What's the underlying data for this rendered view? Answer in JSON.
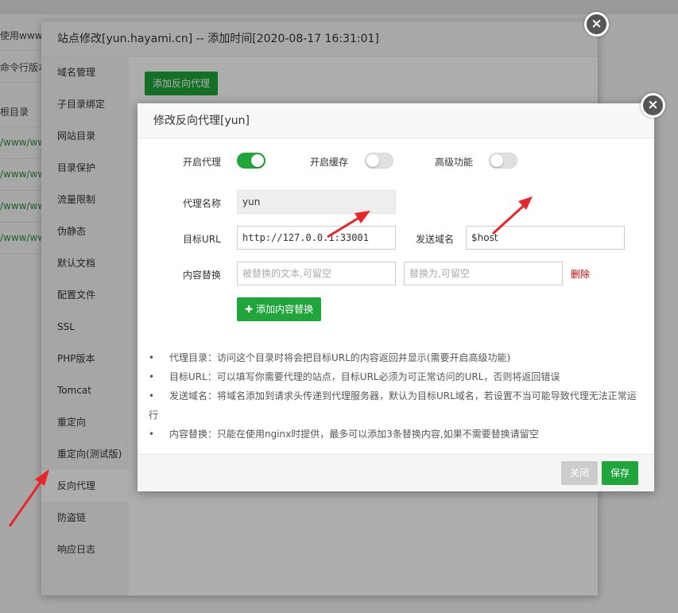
{
  "background": {
    "rows": [
      "使用www.h",
      "命令行版本",
      "根目录",
      "/www/www",
      "/www/www",
      "/www/www",
      "/www/www"
    ]
  },
  "outer_dialog": {
    "title": "站点修改[yun.hayami.cn] -- 添加时间[2020-08-17 16:31:01]",
    "close": "×",
    "add_proxy_label": "添加反向代理",
    "nav": [
      "域名管理",
      "子目录绑定",
      "网站目录",
      "目录保护",
      "流量限制",
      "伪静态",
      "默认文档",
      "配置文件",
      "SSL",
      "PHP版本",
      "Tomcat",
      "重定向",
      "重定向(测试版)",
      "反向代理",
      "防盗链",
      "响应日志"
    ],
    "active_nav": "反向代理"
  },
  "inner_dialog": {
    "title": "修改反向代理[yun]",
    "close": "×",
    "toggles": {
      "enable_proxy": {
        "label": "开启代理",
        "on": true
      },
      "enable_cache": {
        "label": "开启缓存",
        "on": false
      },
      "advanced": {
        "label": "高级功能",
        "on": false
      }
    },
    "proxy_name": {
      "label": "代理名称",
      "value": "yun"
    },
    "target_url": {
      "label": "目标URL",
      "value": "http://127.0.0.1:33001"
    },
    "send_domain": {
      "label": "发送域名",
      "value": "$host"
    },
    "content_replace": {
      "label": "内容替换",
      "from_placeholder": "被替换的文本,可留空",
      "to_placeholder": "替换为,可留空",
      "delete_label": "删除"
    },
    "add_replace_label": "添加内容替换",
    "notes": [
      "代理目录：访问这个目录时将会把目标URL的内容返回并显示(需要开启高级功能)",
      "目标URL：可以填写你需要代理的站点，目标URL必须为可正常访问的URL，否则将返回错误",
      "发送域名：将域名添加到请求头传递到代理服务器，默认为目标URL域名，若设置不当可能导致代理无法正常运行",
      "内容替换：只能在使用nginx时提供，最多可以添加3条替换内容,如果不需要替换请留空"
    ],
    "footer": {
      "close_label": "关闭",
      "save_label": "保存"
    }
  },
  "colors": {
    "accent": "#20a53a",
    "annotation_arrow": "#e8262a",
    "danger": "#cc0000"
  }
}
